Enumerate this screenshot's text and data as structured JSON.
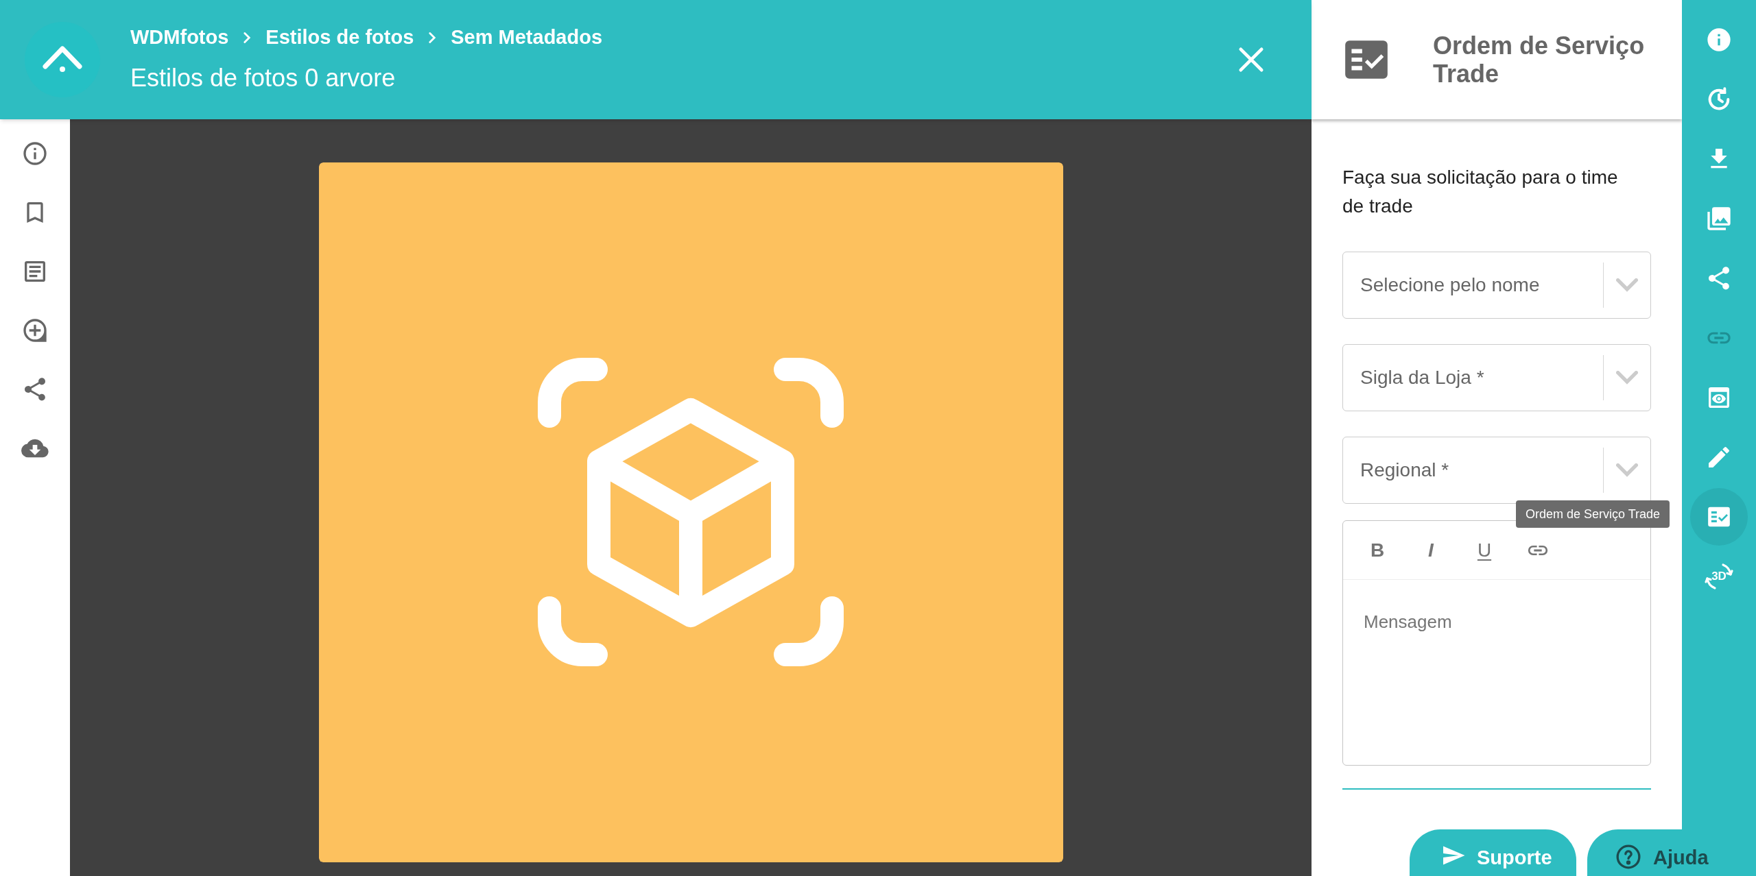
{
  "header": {
    "breadcrumbs": [
      "WDMfotos",
      "Estilos de fotos",
      "Sem Metadados"
    ],
    "title": "Estilos de fotos 0 arvore"
  },
  "left_toolbar": [
    {
      "kind": "info"
    },
    {
      "kind": "bookmark"
    },
    {
      "kind": "document"
    },
    {
      "kind": "add"
    },
    {
      "kind": "share"
    },
    {
      "kind": "cloud-download"
    }
  ],
  "panel": {
    "title": "Ordem de Serviço Trade",
    "intro": "Faça sua solicitação para o  time de trade",
    "selects": [
      {
        "placeholder": "Selecione pelo nome"
      },
      {
        "placeholder": "Sigla da Loja *"
      },
      {
        "placeholder": "Regional *"
      }
    ],
    "editor": {
      "tools": [
        {
          "kind": "bold",
          "label": "B"
        },
        {
          "kind": "italic",
          "label": "I"
        },
        {
          "kind": "underline",
          "label": "U"
        },
        {
          "kind": "link"
        }
      ],
      "placeholder": "Mensagem"
    }
  },
  "right_rail": [
    {
      "kind": "info",
      "selected": false,
      "disabled": false
    },
    {
      "kind": "history",
      "selected": false,
      "disabled": false
    },
    {
      "kind": "download",
      "selected": false,
      "disabled": false
    },
    {
      "kind": "photos",
      "selected": false,
      "disabled": false
    },
    {
      "kind": "share",
      "selected": false,
      "disabled": false
    },
    {
      "kind": "link",
      "selected": false,
      "disabled": true
    },
    {
      "kind": "preview",
      "selected": false,
      "disabled": false
    },
    {
      "kind": "edit",
      "selected": false,
      "disabled": false
    },
    {
      "kind": "checklist",
      "selected": true,
      "disabled": false
    },
    {
      "kind": "rotate3d",
      "label": "3D",
      "selected": false,
      "disabled": false
    }
  ],
  "tooltip": "Ordem de Serviço Trade",
  "buttons": [
    {
      "kind": "send",
      "label": "Suporte"
    },
    {
      "kind": "help",
      "label": "Ajuda"
    }
  ]
}
